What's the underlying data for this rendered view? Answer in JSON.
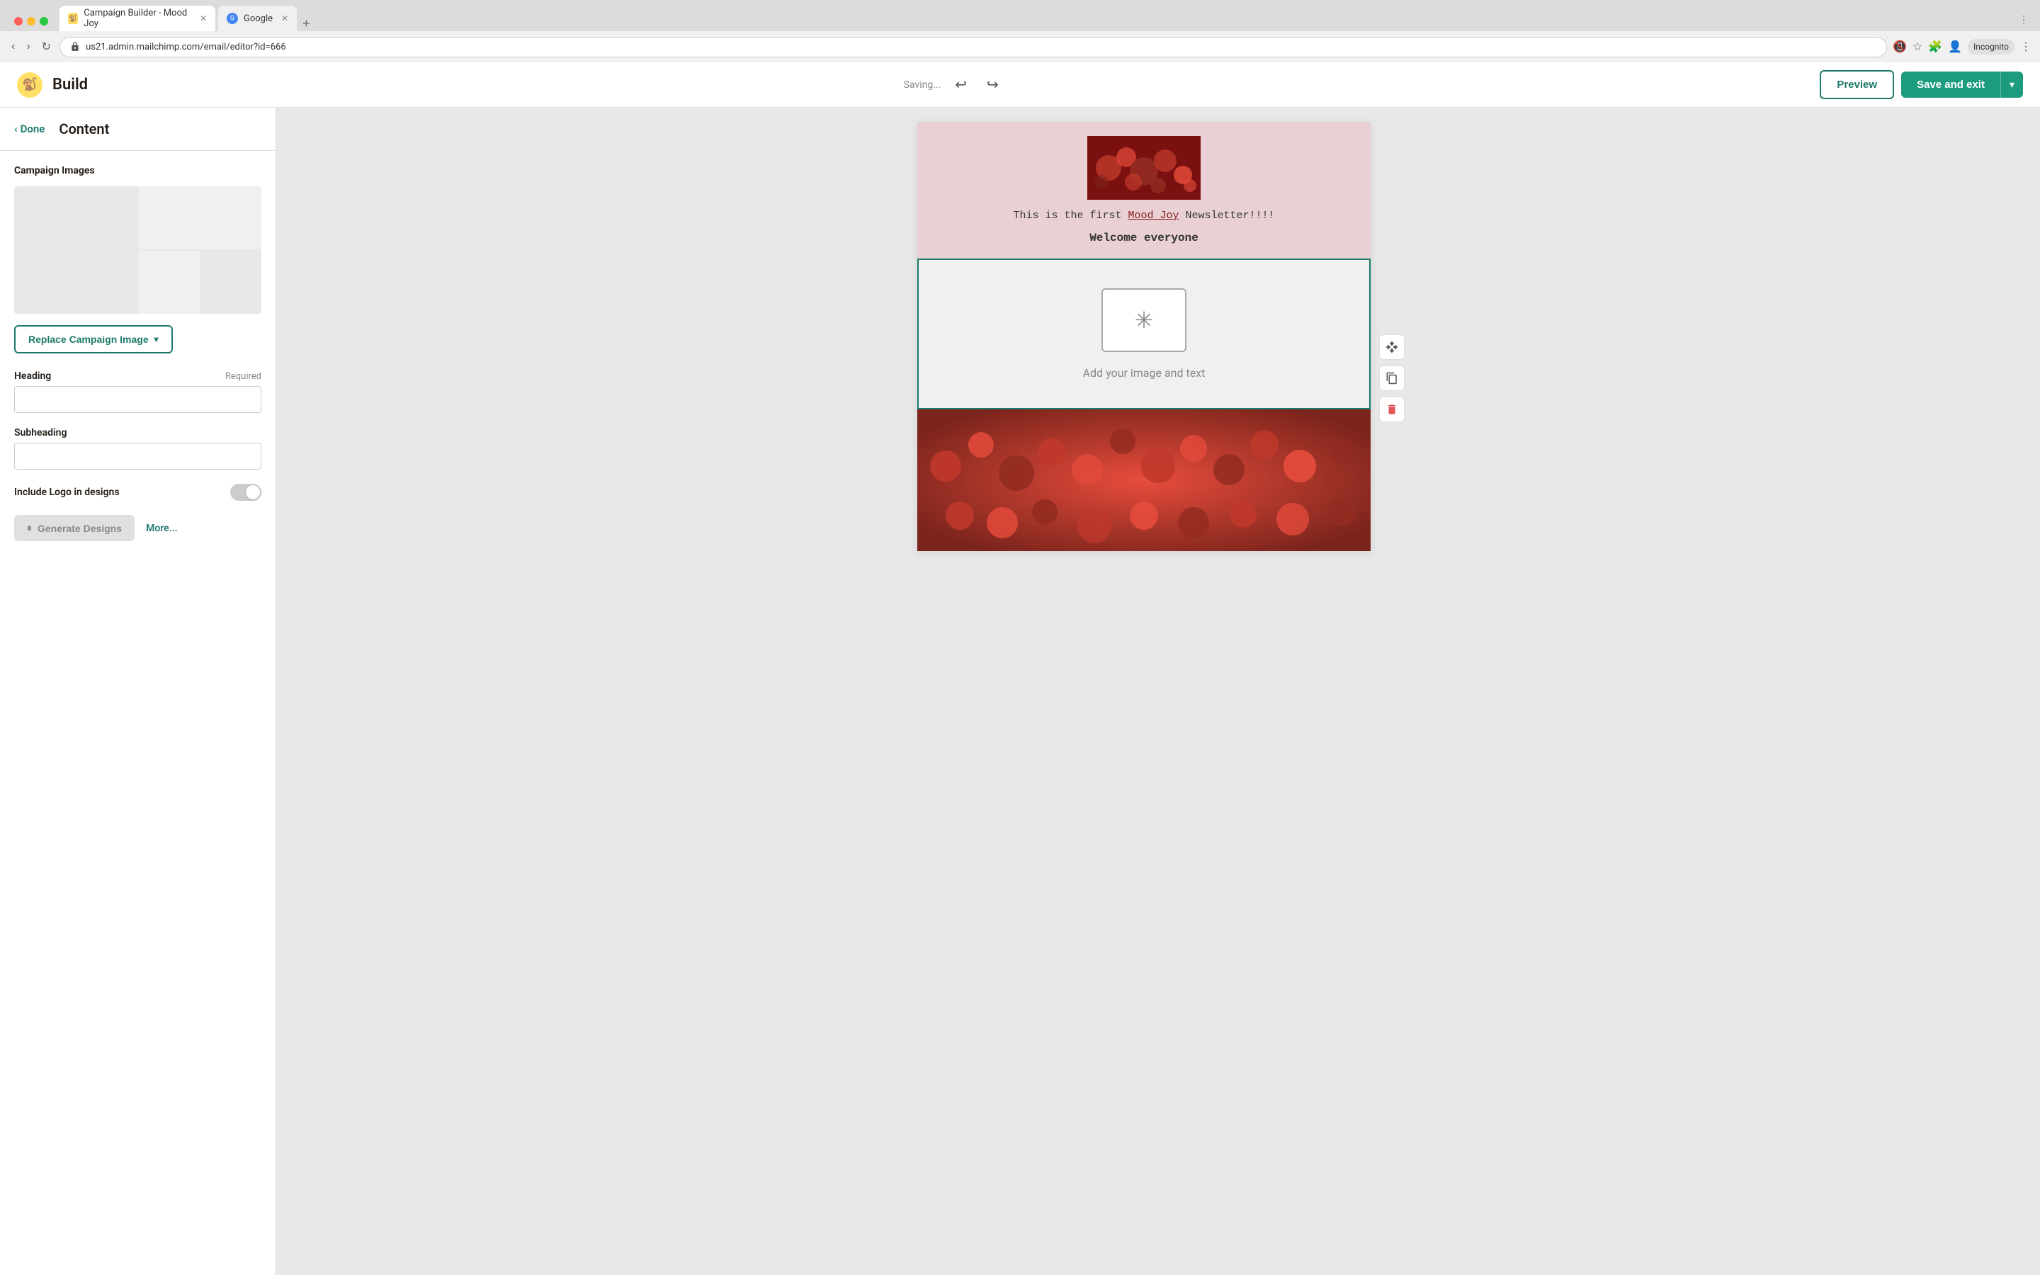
{
  "browser": {
    "traffic_lights": [
      "red",
      "yellow",
      "green"
    ],
    "tabs": [
      {
        "label": "Campaign Builder - Mood Joy",
        "active": true,
        "favicon": "mailchimp"
      },
      {
        "label": "Google",
        "active": false,
        "favicon": "google"
      }
    ],
    "new_tab_label": "+",
    "address": "us21.admin.mailchimp.com/email/editor?id=666",
    "nav_back": "‹",
    "nav_forward": "›",
    "nav_reload": "↻",
    "incognito_label": "Incognito"
  },
  "topbar": {
    "logo_emoji": "🐒",
    "build_label": "Build",
    "saving_label": "Saving...",
    "undo_icon": "↩",
    "redo_icon": "↪",
    "preview_label": "Preview",
    "save_exit_label": "Save and exit",
    "save_exit_dropdown_icon": "▾"
  },
  "sidebar": {
    "done_label": "Done",
    "done_icon": "‹",
    "title": "Content",
    "campaign_images_label": "Campaign Images",
    "replace_btn_label": "Replace Campaign Image",
    "replace_btn_chevron": "▾",
    "heading_label": "Heading",
    "heading_required": "Required",
    "heading_placeholder": "",
    "subheading_label": "Subheading",
    "subheading_placeholder": "",
    "logo_label": "Include Logo in designs",
    "generate_btn_label": "Generate Designs",
    "generate_icon": "⏸",
    "more_label": "More..."
  },
  "email": {
    "flower_image_alt": "Red flowers",
    "text1_prefix": "This is the first ",
    "text1_link": "Mood Joy",
    "text1_suffix": " Newsletter!!!!",
    "text2": "Welcome everyone",
    "placeholder_text": "Add your image and text",
    "placeholder_icon": "✳"
  },
  "toolbar": {
    "move_icon": "⤢",
    "copy_icon": "⧉",
    "delete_icon": "🗑"
  }
}
